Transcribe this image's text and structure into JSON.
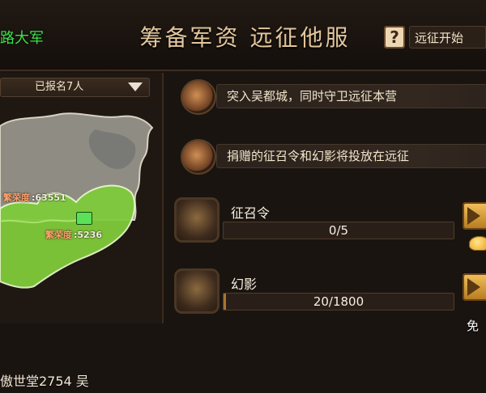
{
  "header": {
    "left_tag": "路大军",
    "title": "筹备军资 远征他服",
    "help_icon": "?",
    "start_label": "远征开始"
  },
  "left_panel": {
    "dropdown_label": "已报名7人",
    "map_labels": [
      {
        "name": "繁荣度",
        "value": ":63551"
      },
      {
        "name": "繁荣度",
        "value": ":5236"
      }
    ],
    "bottom_text": "傲世堂2754 吴"
  },
  "objectives": [
    {
      "text": "突入吴都城，同时守卫远征本营",
      "icon": "flag-icon"
    },
    {
      "text": "捐赠的征召令和幻影将投放在远征",
      "icon": "scroll-icon"
    }
  ],
  "items": [
    {
      "label": "征召令",
      "progress_text": "0/5",
      "progress": 0.0,
      "icon": "token-icon"
    },
    {
      "label": "幻影",
      "progress_text": "20/1800",
      "progress": 0.011,
      "icon": "general-portrait-icon"
    }
  ],
  "side": {
    "free_label": "免"
  },
  "colors": {
    "accent_green": "#3ee24a",
    "gold": "#e3c69b",
    "progress_fill": "#a8742f"
  }
}
